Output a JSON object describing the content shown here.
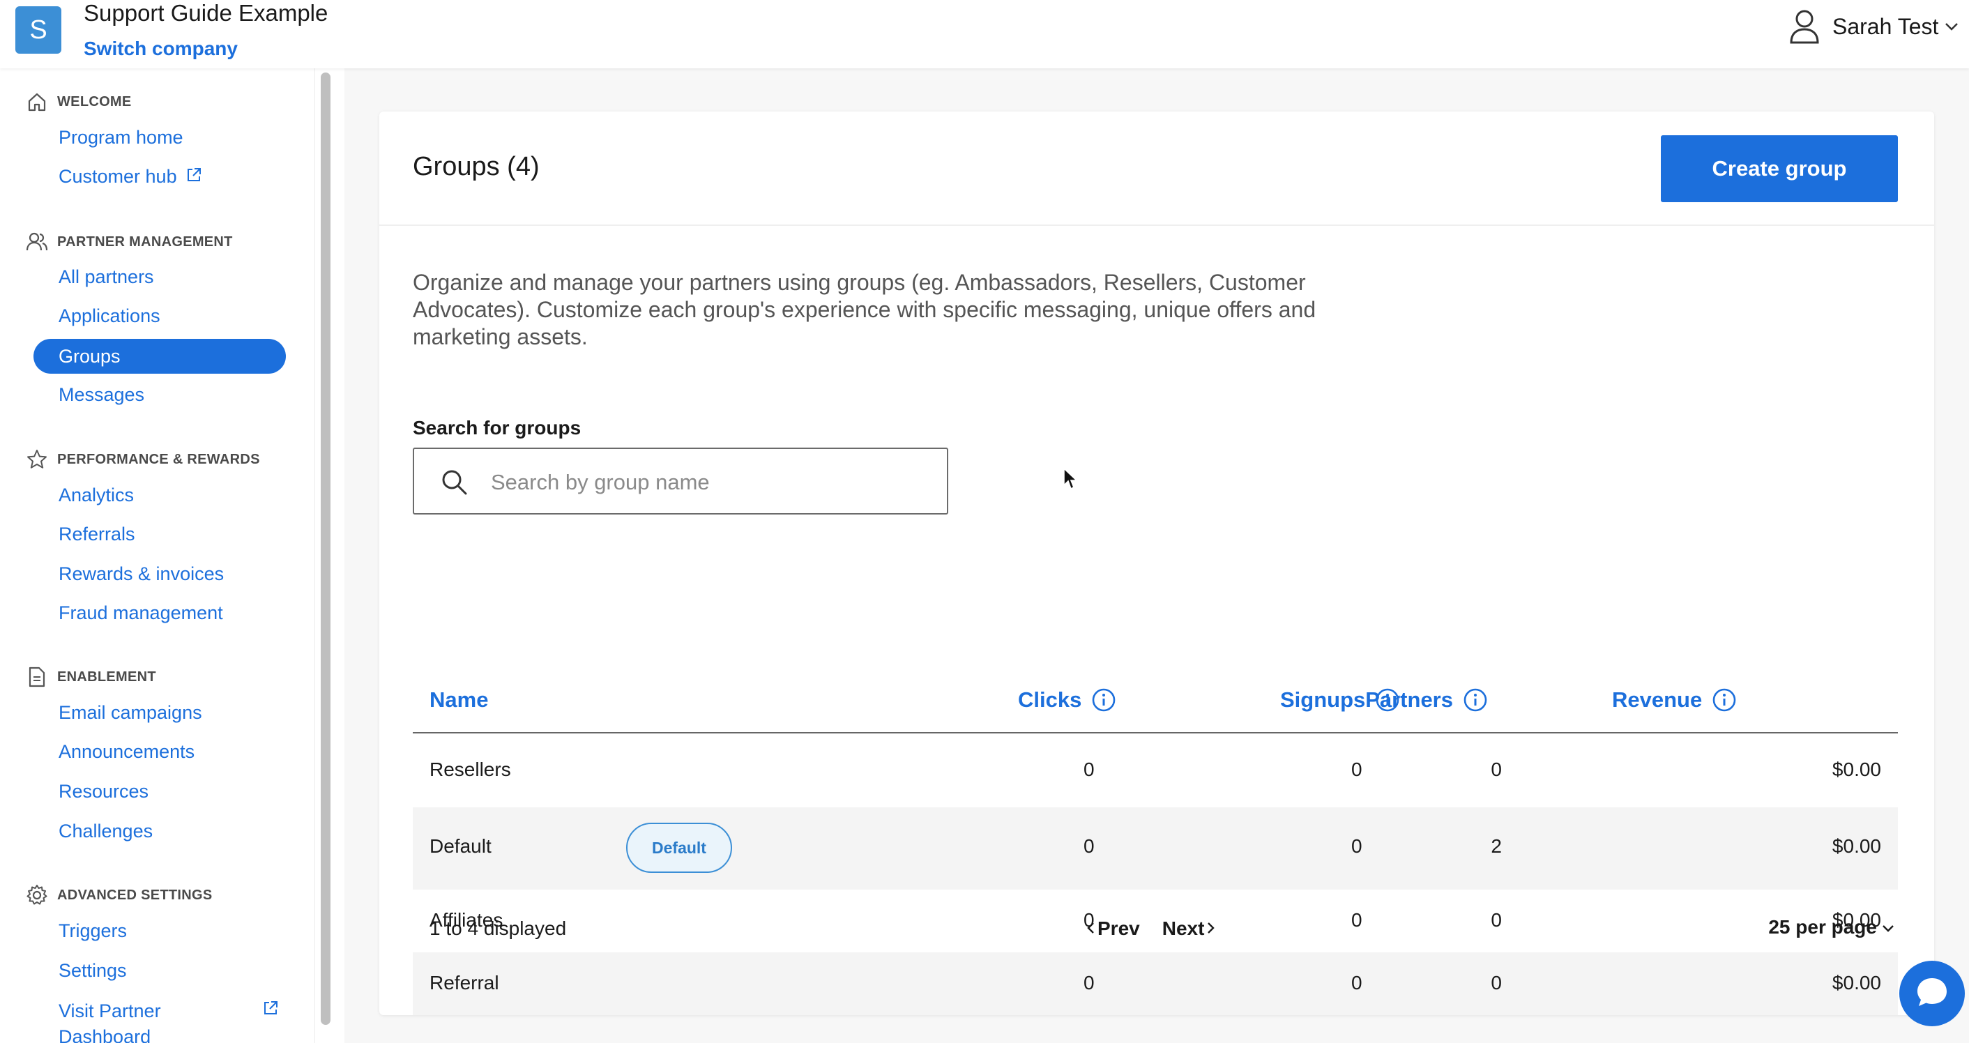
{
  "topbar": {
    "company_initial": "S",
    "company_name": "Support Guide Example",
    "switch_company": "Switch company",
    "user_name": "Sarah Test"
  },
  "sidebar": {
    "sections": [
      {
        "heading": "WELCOME",
        "icon": "home-icon",
        "items": [
          {
            "label": "Program home"
          },
          {
            "label": "Customer hub",
            "external": true
          }
        ]
      },
      {
        "heading": "PARTNER MANAGEMENT",
        "icon": "users-icon",
        "items": [
          {
            "label": "All partners"
          },
          {
            "label": "Applications"
          },
          {
            "label": "Groups",
            "active": true
          },
          {
            "label": "Messages"
          }
        ]
      },
      {
        "heading": "PERFORMANCE & REWARDS",
        "icon": "star-icon",
        "items": [
          {
            "label": "Analytics"
          },
          {
            "label": "Referrals"
          },
          {
            "label": "Rewards & invoices"
          },
          {
            "label": "Fraud management"
          }
        ]
      },
      {
        "heading": "ENABLEMENT",
        "icon": "document-icon",
        "items": [
          {
            "label": "Email campaigns"
          },
          {
            "label": "Announcements"
          },
          {
            "label": "Resources"
          },
          {
            "label": "Challenges"
          }
        ]
      },
      {
        "heading": "ADVANCED SETTINGS",
        "icon": "gear-icon",
        "items": [
          {
            "label": "Triggers"
          },
          {
            "label": "Settings"
          },
          {
            "label": "Visit Partner Dashboard",
            "external": true
          }
        ]
      }
    ]
  },
  "main": {
    "title": "Groups (4)",
    "create_button": "Create group",
    "description": "Organize and manage your partners using groups (eg. Ambassadors, Resellers, Customer Advocates). Customize each group's experience with specific messaging, unique offers and marketing assets.",
    "search_label": "Search for groups",
    "search_placeholder": "Search by group name",
    "search_value": "",
    "table": {
      "columns": [
        "Name",
        "Partners",
        "Clicks",
        "Signups",
        "Revenue"
      ],
      "rows": [
        {
          "name": "Resellers",
          "badge": "",
          "partners": "0",
          "clicks": "0",
          "signups": "0",
          "revenue": "$0.00"
        },
        {
          "name": "Default",
          "badge": "Default",
          "partners": "2",
          "clicks": "0",
          "signups": "0",
          "revenue": "$0.00"
        },
        {
          "name": "Affiliates",
          "badge": "",
          "partners": "0",
          "clicks": "0",
          "signups": "0",
          "revenue": "$0.00"
        },
        {
          "name": "Referral",
          "badge": "",
          "partners": "0",
          "clicks": "0",
          "signups": "0",
          "revenue": "$0.00"
        }
      ]
    },
    "footer": {
      "displayed": "1 to 4 displayed",
      "prev": "Prev",
      "next": "Next",
      "per_page": "25 per page"
    }
  },
  "colors": {
    "accent": "#1c6fdc",
    "avatar": "#3c8fd6"
  }
}
